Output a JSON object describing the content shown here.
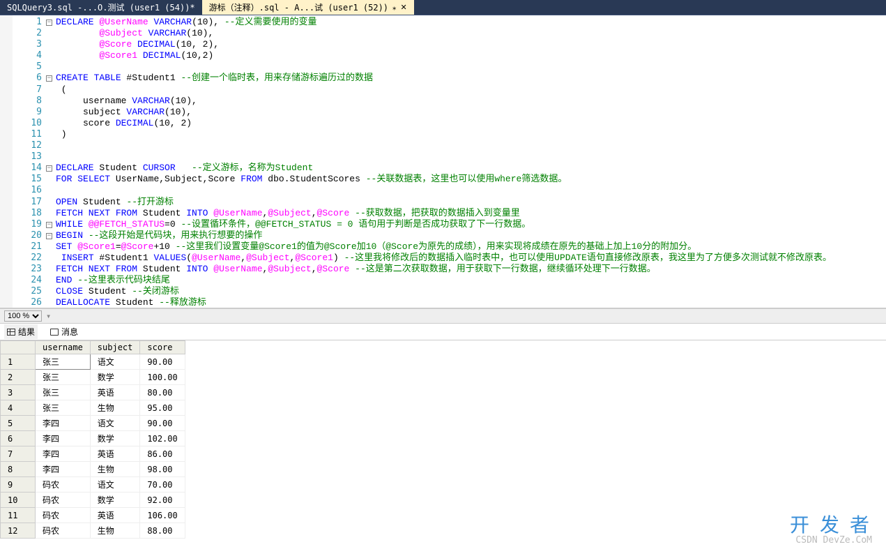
{
  "tabs": [
    {
      "label": "SQLQuery3.sql -...O.测试 (user1 (54))*",
      "active": false
    },
    {
      "label": "游标（注释）.sql - A...试 (user1 (52))",
      "active": true
    }
  ],
  "zoom": "100 %",
  "resultsTabs": {
    "results": "结果",
    "messages": "消息"
  },
  "code": {
    "lines": [
      {
        "n": 1,
        "fold": "-",
        "segs": [
          [
            "kw",
            "DECLARE"
          ],
          [
            "",
            " "
          ],
          [
            "sv",
            "@UserName"
          ],
          [
            "",
            " "
          ],
          [
            "kw",
            "VARCHAR"
          ],
          [
            "",
            "(10), "
          ],
          [
            "cm",
            "--定义需要使用的变量"
          ]
        ]
      },
      {
        "n": 2,
        "segs": [
          [
            "",
            "        "
          ],
          [
            "sv",
            "@Subject"
          ],
          [
            "",
            " "
          ],
          [
            "kw",
            "VARCHAR"
          ],
          [
            "",
            "(10),"
          ]
        ]
      },
      {
        "n": 3,
        "segs": [
          [
            "",
            "        "
          ],
          [
            "sv",
            "@Score"
          ],
          [
            "",
            " "
          ],
          [
            "kw",
            "DECIMAL"
          ],
          [
            "",
            "(10, 2),"
          ]
        ]
      },
      {
        "n": 4,
        "segs": [
          [
            "",
            "        "
          ],
          [
            "sv",
            "@Score1"
          ],
          [
            "",
            " "
          ],
          [
            "kw",
            "DECIMAL"
          ],
          [
            "",
            "(10,2)"
          ]
        ]
      },
      {
        "n": 5,
        "segs": []
      },
      {
        "n": 6,
        "fold": "-",
        "segs": [
          [
            "kw",
            "CREATE TABLE"
          ],
          [
            "",
            " #Student1 "
          ],
          [
            "cm",
            "--创建一个临时表，用来存储游标遍历过的数据"
          ]
        ]
      },
      {
        "n": 7,
        "segs": [
          [
            "",
            " ("
          ]
        ]
      },
      {
        "n": 8,
        "segs": [
          [
            "",
            "     username "
          ],
          [
            "kw",
            "VARCHAR"
          ],
          [
            "",
            "(10),"
          ]
        ]
      },
      {
        "n": 9,
        "segs": [
          [
            "",
            "     subject "
          ],
          [
            "kw",
            "VARCHAR"
          ],
          [
            "",
            "(10),"
          ]
        ]
      },
      {
        "n": 10,
        "segs": [
          [
            "",
            "     score "
          ],
          [
            "kw",
            "DECIMAL"
          ],
          [
            "",
            "(10, 2)"
          ]
        ]
      },
      {
        "n": 11,
        "segs": [
          [
            "",
            " )"
          ]
        ]
      },
      {
        "n": 12,
        "segs": []
      },
      {
        "n": 13,
        "segs": []
      },
      {
        "n": 14,
        "fold": "-",
        "segs": [
          [
            "kw",
            "DECLARE"
          ],
          [
            "",
            " Student "
          ],
          [
            "kw",
            "CURSOR"
          ],
          [
            "",
            "   "
          ],
          [
            "cm",
            "--定义游标，名称为Student"
          ]
        ]
      },
      {
        "n": 15,
        "segs": [
          [
            "kw",
            "FOR"
          ],
          [
            "",
            " "
          ],
          [
            "kw",
            "SELECT"
          ],
          [
            "",
            " UserName,Subject,Score "
          ],
          [
            "kw",
            "FROM"
          ],
          [
            "",
            " dbo.StudentScores "
          ],
          [
            "cm",
            "--关联数据表，这里也可以使用where筛选数据。"
          ]
        ]
      },
      {
        "n": 16,
        "segs": []
      },
      {
        "n": 17,
        "segs": [
          [
            "kw",
            "OPEN"
          ],
          [
            "",
            " Student "
          ],
          [
            "cm",
            "--打开游标"
          ]
        ]
      },
      {
        "n": 18,
        "segs": [
          [
            "kw",
            "FETCH NEXT FROM"
          ],
          [
            "",
            " Student "
          ],
          [
            "kw",
            "INTO"
          ],
          [
            "",
            " "
          ],
          [
            "sv",
            "@UserName"
          ],
          [
            "",
            ","
          ],
          [
            "sv",
            "@Subject"
          ],
          [
            "",
            ","
          ],
          [
            "sv",
            "@Score"
          ],
          [
            "",
            " "
          ],
          [
            "cm",
            "--获取数据，把获取的数据插入到变量里"
          ]
        ]
      },
      {
        "n": 19,
        "fold": "-",
        "segs": [
          [
            "kw",
            "WHILE"
          ],
          [
            "",
            " "
          ],
          [
            "sv",
            "@@FETCH_STATUS"
          ],
          [
            "",
            "=0 "
          ],
          [
            "cm",
            "--设置循环条件，@@FETCH_STATUS = 0 语句用于判断是否成功获取了下一行数据。"
          ]
        ]
      },
      {
        "n": 20,
        "fold": "-",
        "segs": [
          [
            "kw",
            "BEGIN"
          ],
          [
            "",
            " "
          ],
          [
            "cm",
            "--这段开始是代码块，用来执行想要的操作"
          ]
        ]
      },
      {
        "n": 21,
        "segs": [
          [
            "kw",
            "SET"
          ],
          [
            "",
            " "
          ],
          [
            "sv",
            "@Score1"
          ],
          [
            "",
            "="
          ],
          [
            "sv",
            "@Score"
          ],
          [
            "",
            "+10 "
          ],
          [
            "cm",
            "--这里我们设置变量@Score1的值为@Score加10（@Score为原先的成绩），用来实现将成绩在原先的基础上加上10分的附加分。"
          ]
        ]
      },
      {
        "n": 22,
        "segs": [
          [
            "",
            " "
          ],
          [
            "kw",
            "INSERT"
          ],
          [
            "",
            " #Student1 "
          ],
          [
            "kw",
            "VALUES"
          ],
          [
            "",
            "("
          ],
          [
            "sv",
            "@UserName"
          ],
          [
            "",
            ","
          ],
          [
            "sv",
            "@Subject"
          ],
          [
            "",
            ","
          ],
          [
            "sv",
            "@Score1"
          ],
          [
            "",
            ") "
          ],
          [
            "cm",
            "--这里我将修改后的数据插入临时表中，也可以使用UPDATE语句直接修改原表，我这里为了方便多次测试就不修改原表。"
          ]
        ]
      },
      {
        "n": 23,
        "segs": [
          [
            "kw",
            "FETCH NEXT FROM"
          ],
          [
            "",
            " Student "
          ],
          [
            "kw",
            "INTO"
          ],
          [
            "",
            " "
          ],
          [
            "sv",
            "@UserName"
          ],
          [
            "",
            ","
          ],
          [
            "sv",
            "@Subject"
          ],
          [
            "",
            ","
          ],
          [
            "sv",
            "@Score"
          ],
          [
            "",
            " "
          ],
          [
            "cm",
            "--这是第二次获取数据，用于获取下一行数据，继续循环处理下一行数据。"
          ]
        ]
      },
      {
        "n": 24,
        "segs": [
          [
            "kw",
            "END"
          ],
          [
            "",
            " "
          ],
          [
            "cm",
            "--这里表示代码块结尾"
          ]
        ]
      },
      {
        "n": 25,
        "segs": [
          [
            "kw",
            "CLOSE"
          ],
          [
            "",
            " Student "
          ],
          [
            "cm",
            "--关闭游标"
          ]
        ]
      },
      {
        "n": 26,
        "segs": [
          [
            "kw",
            "DEALLOCATE"
          ],
          [
            "",
            " Student "
          ],
          [
            "cm",
            "--释放游标"
          ]
        ]
      }
    ]
  },
  "results": {
    "headers": [
      "",
      "username",
      "subject",
      "score"
    ],
    "rows": [
      [
        "1",
        "张三",
        "语文",
        "90.00"
      ],
      [
        "2",
        "张三",
        "数学",
        "100.00"
      ],
      [
        "3",
        "张三",
        "英语",
        "80.00"
      ],
      [
        "4",
        "张三",
        "生物",
        "95.00"
      ],
      [
        "5",
        "李四",
        "语文",
        "90.00"
      ],
      [
        "6",
        "李四",
        "数学",
        "102.00"
      ],
      [
        "7",
        "李四",
        "英语",
        "86.00"
      ],
      [
        "8",
        "李四",
        "生物",
        "98.00"
      ],
      [
        "9",
        "码农",
        "语文",
        "70.00"
      ],
      [
        "10",
        "码农",
        "数学",
        "92.00"
      ],
      [
        "11",
        "码农",
        "英语",
        "106.00"
      ],
      [
        "12",
        "码农",
        "生物",
        "88.00"
      ]
    ]
  },
  "watermark": {
    "big": "开 发 者",
    "small": "CSDN DevZe.CoM"
  }
}
